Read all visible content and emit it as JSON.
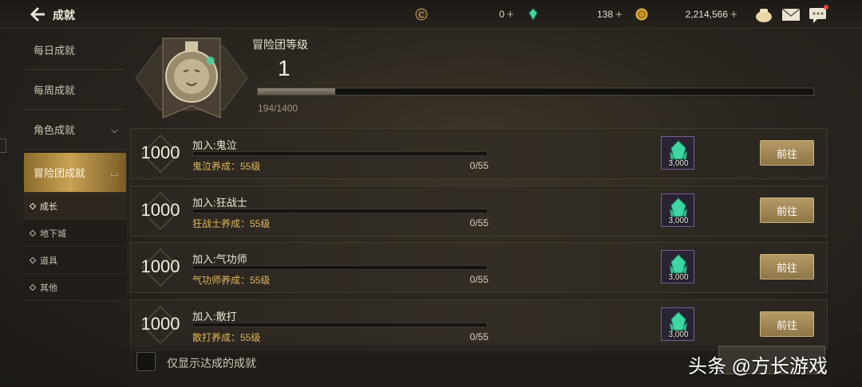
{
  "header": {
    "title": "成就",
    "currencies": [
      {
        "icon": "cera-coin-icon",
        "value": "0"
      },
      {
        "icon": "crystal-icon",
        "value": "138"
      },
      {
        "icon": "gold-coin-icon",
        "value": "2,214,566"
      }
    ],
    "icons": [
      "gold-pouch-icon",
      "mail-icon",
      "chat-icon"
    ]
  },
  "sidebar": {
    "items": [
      {
        "label": "每日成就"
      },
      {
        "label": "每周成就"
      },
      {
        "label": "角色成就"
      },
      {
        "label": "冒险团成就"
      }
    ],
    "subitems": [
      {
        "label": "成长"
      },
      {
        "label": "地下城"
      },
      {
        "label": "道具"
      },
      {
        "label": "其他"
      }
    ]
  },
  "level": {
    "label": "冒险团等级",
    "value": "1",
    "progress_text": "194/1400",
    "progress_fraction": 0.139
  },
  "achievements": [
    {
      "points": "1000",
      "title": "加入:鬼泣",
      "desc": "鬼泣养成：55级",
      "count": "0/55",
      "progress": 0,
      "reward_qty": "3,000",
      "button": "前往"
    },
    {
      "points": "1000",
      "title": "加入:狂战士",
      "desc": "狂战士养成：55级",
      "count": "0/55",
      "progress": 0,
      "reward_qty": "3,000",
      "button": "前往"
    },
    {
      "points": "1000",
      "title": "加入:气功师",
      "desc": "气功师养成：55级",
      "count": "0/55",
      "progress": 0,
      "reward_qty": "3,000",
      "button": "前往"
    },
    {
      "points": "1000",
      "title": "加入:散打",
      "desc": "散打养成：55级",
      "count": "0/55",
      "progress": 0,
      "reward_qty": "3,000",
      "button": "前往"
    }
  ],
  "footer": {
    "checkbox_label": "仅显示达成的成就",
    "watermark": "头条 @方长游戏"
  },
  "colors": {
    "accent_gold": "#c8a255",
    "desc_text": "#e0b75a",
    "reward_crystal": "#3fd6a4"
  }
}
